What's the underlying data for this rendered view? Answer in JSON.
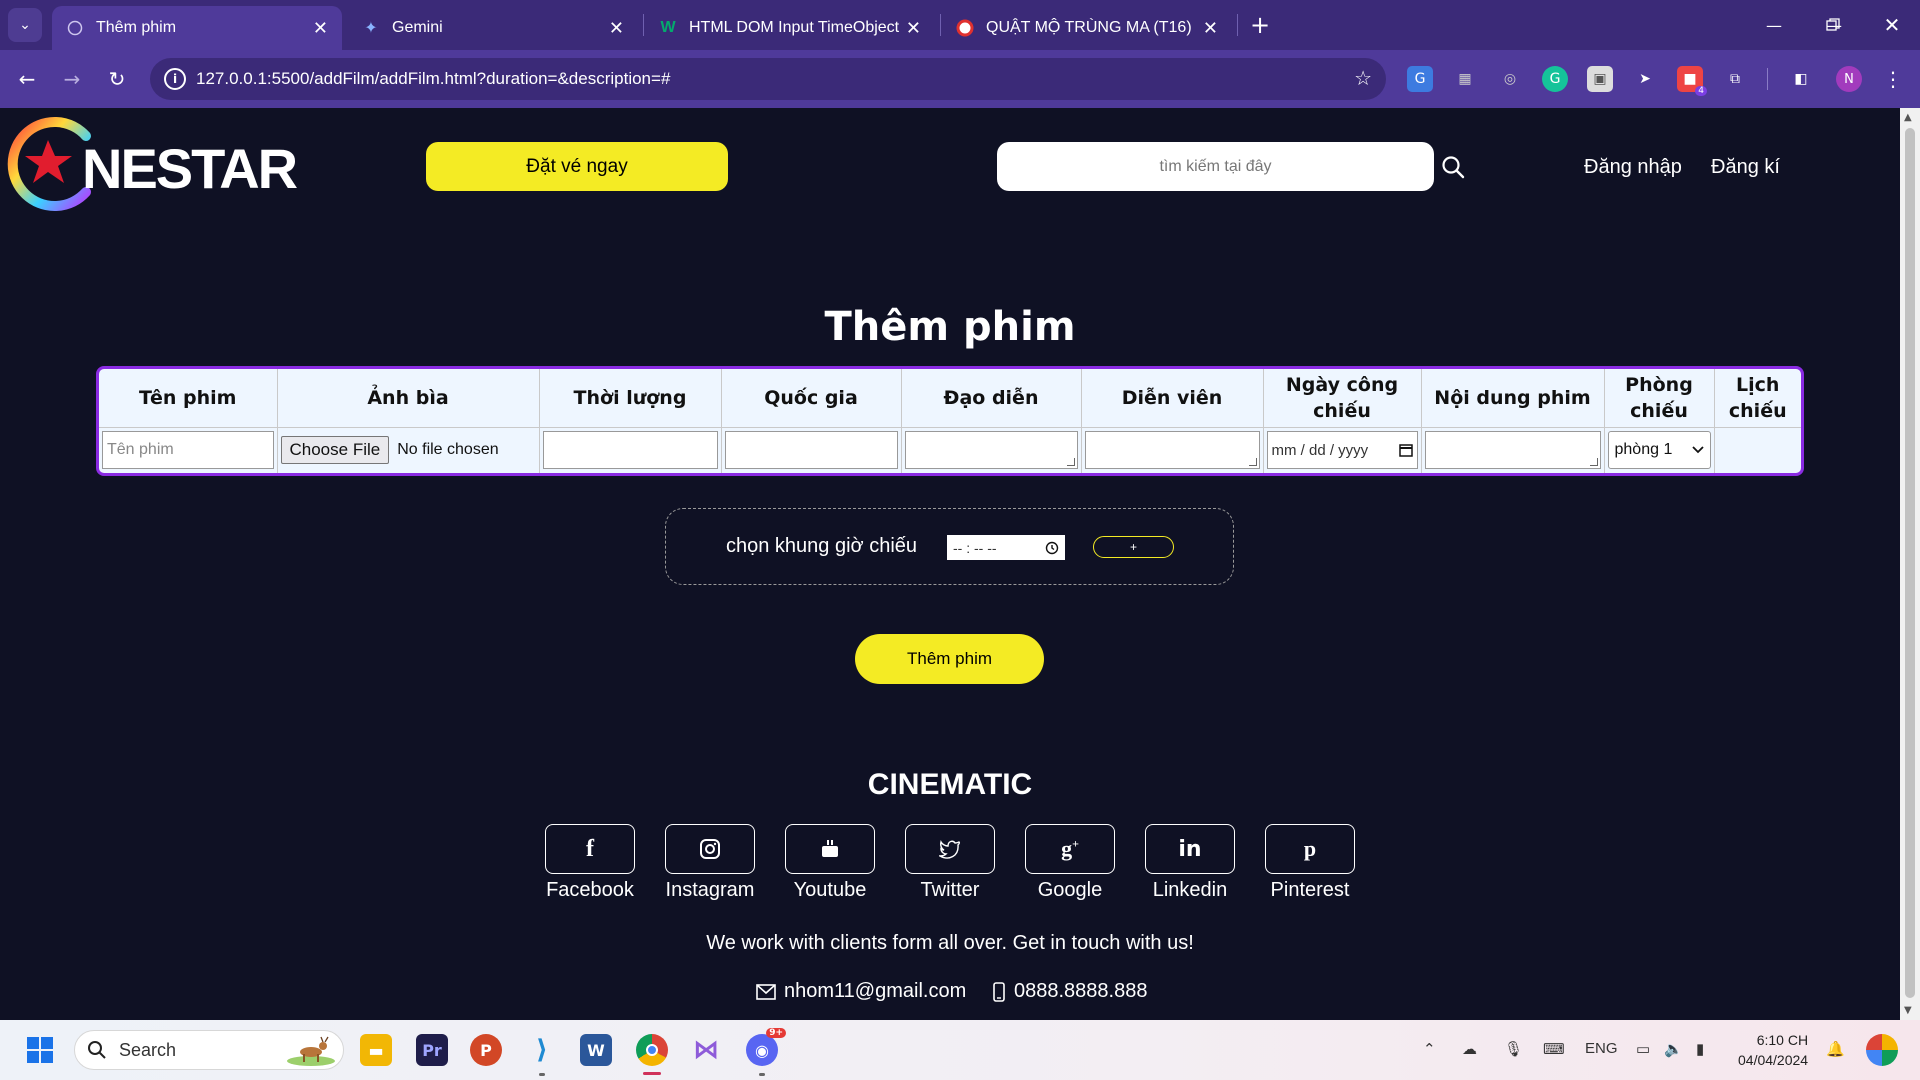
{
  "browser": {
    "tabs": [
      {
        "title": "Thêm phim",
        "active": true
      },
      {
        "title": "Gemini",
        "active": false
      },
      {
        "title": "HTML DOM Input TimeObject",
        "active": false
      },
      {
        "title": "QUẬT MỘ TRÙNG MA (T16)",
        "active": false
      }
    ],
    "url": "127.0.0.1:5500/addFilm/addFilm.html?duration=&description=#",
    "profile_initial": "N",
    "extension_badge": "4"
  },
  "header": {
    "logo_text": "NESTAR",
    "book_button": "Đặt vé ngay",
    "search_placeholder": "tìm kiếm tại đây",
    "login": "Đăng nhập",
    "register": "Đăng kí"
  },
  "page_title": "Thêm phim",
  "form_table": {
    "headers": [
      "Tên phim",
      "Ảnh bìa",
      "Thời lượng",
      "Quốc gia",
      "Đạo diễn",
      "Diễn viên",
      "Ngày công chiếu",
      "Nội dung phim",
      "Phòng chiếu",
      "Lịch chiếu"
    ],
    "name_placeholder": "Tên phim",
    "file_button": "Choose File",
    "file_status": "No file chosen",
    "date_placeholder": "mm / dd / yyyy",
    "room_selected": "phòng 1"
  },
  "schedule": {
    "label": "chọn khung giờ chiếu",
    "time_placeholder": "-- : --  --",
    "add_button": "+"
  },
  "submit_button": "Thêm phim",
  "footer": {
    "title": "CINEMATIC",
    "socials": [
      "Facebook",
      "Instagram",
      "Youtube",
      "Twitter",
      "Google",
      "Linkedin",
      "Pinterest"
    ],
    "note": "We work with clients form all over. Get in touch with us!",
    "email": "nhom11@gmail.com",
    "phone": "0888.8888.888"
  },
  "taskbar": {
    "search_label": "Search",
    "language": "ENG",
    "time": "6:10 CH",
    "date": "04/04/2024",
    "discord_badge": "9+"
  },
  "colors": {
    "accent_yellow": "#f4eb24",
    "page_bg": "#0f1124",
    "chrome_purple": "#4f3a9a",
    "table_border": "#8a2be2"
  }
}
